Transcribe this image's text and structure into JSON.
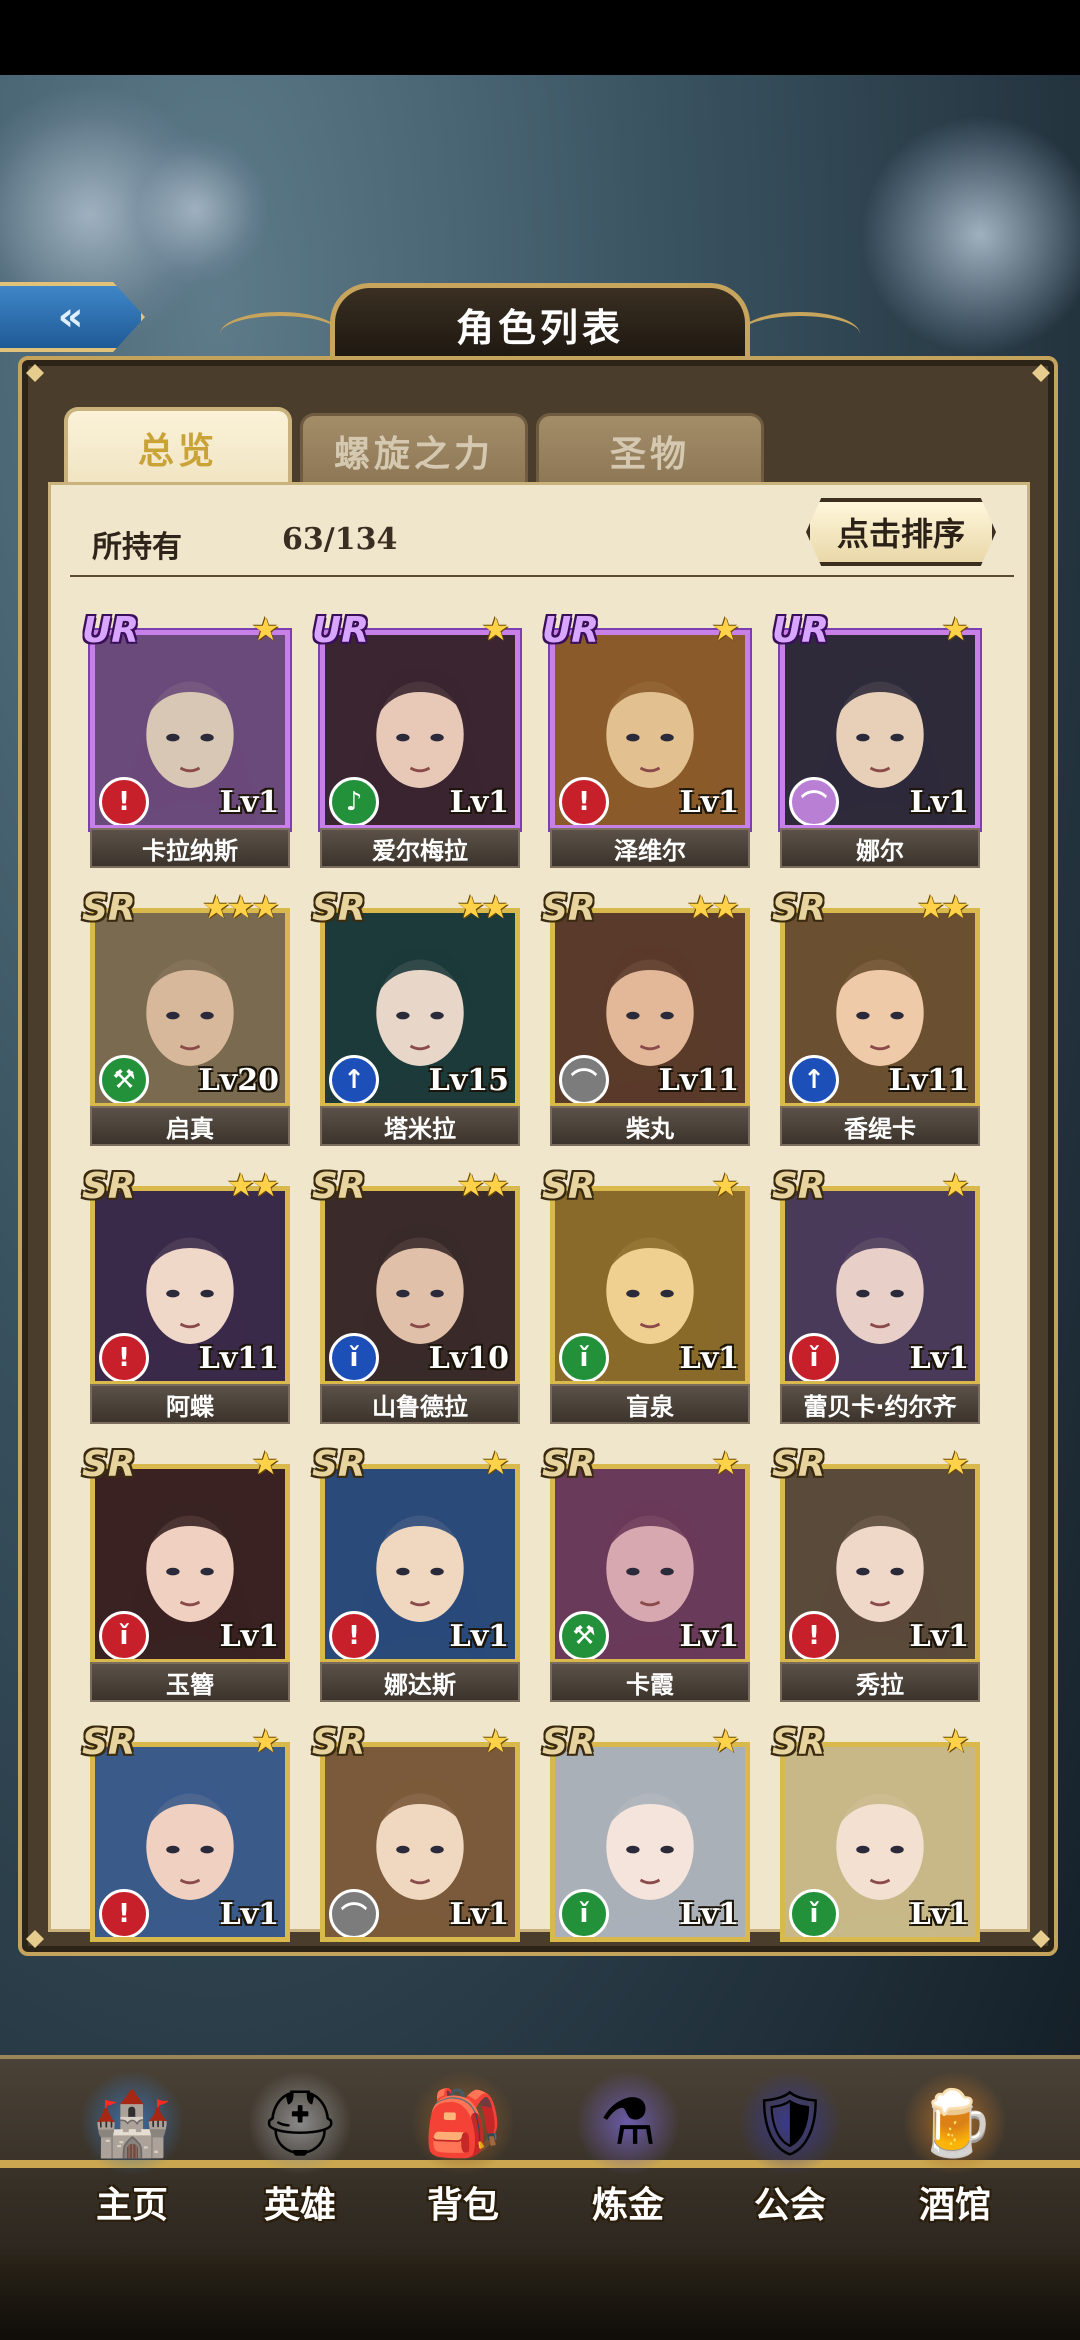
{
  "title": "角色列表",
  "back_icon": "double-chevron-left-icon",
  "tabs": [
    {
      "label": "总览",
      "active": true
    },
    {
      "label": "螺旋之力",
      "active": false
    },
    {
      "label": "圣物",
      "active": false
    }
  ],
  "owned": {
    "label": "所持有",
    "count": "63/134"
  },
  "sort_button": "点击排序",
  "class_colors": {
    "red": "#c8202b",
    "green": "#22913a",
    "blue": "#1d4fb8",
    "gray": "#7c7c7c",
    "purple": "#b97fd4"
  },
  "characters": [
    {
      "name": "卡拉纳斯",
      "rarity": "UR",
      "stars": 1,
      "level": "Lv1",
      "class_icon": "sword-icon",
      "class_color": "red"
    },
    {
      "name": "爱尔梅拉",
      "rarity": "UR",
      "stars": 1,
      "level": "Lv1",
      "class_icon": "harp-icon",
      "class_color": "green"
    },
    {
      "name": "泽维尔",
      "rarity": "UR",
      "stars": 1,
      "level": "Lv1",
      "class_icon": "sword-icon",
      "class_color": "red"
    },
    {
      "name": "娜尔",
      "rarity": "UR",
      "stars": 1,
      "level": "Lv1",
      "class_icon": "bow-icon",
      "class_color": "purple"
    },
    {
      "name": "启真",
      "rarity": "SR",
      "stars": 3,
      "level": "Lv20",
      "class_icon": "axe-icon",
      "class_color": "green"
    },
    {
      "name": "塔米拉",
      "rarity": "SR",
      "stars": 2,
      "level": "Lv15",
      "class_icon": "spear-icon",
      "class_color": "blue"
    },
    {
      "name": "柴丸",
      "rarity": "SR",
      "stars": 2,
      "level": "Lv11",
      "class_icon": "bow-icon",
      "class_color": "gray"
    },
    {
      "name": "香缇卡",
      "rarity": "SR",
      "stars": 2,
      "level": "Lv11",
      "class_icon": "spear-icon",
      "class_color": "blue"
    },
    {
      "name": "阿蝶",
      "rarity": "SR",
      "stars": 2,
      "level": "Lv11",
      "class_icon": "sword-icon",
      "class_color": "red"
    },
    {
      "name": "山鲁德拉",
      "rarity": "SR",
      "stars": 2,
      "level": "Lv10",
      "class_icon": "staff-icon",
      "class_color": "blue"
    },
    {
      "name": "盲泉",
      "rarity": "SR",
      "stars": 1,
      "level": "Lv1",
      "class_icon": "staff-icon",
      "class_color": "green"
    },
    {
      "name": "蕾贝卡·约尔齐",
      "rarity": "SR",
      "stars": 1,
      "level": "Lv1",
      "class_icon": "staff-icon",
      "class_color": "red"
    },
    {
      "name": "玉簪",
      "rarity": "SR",
      "stars": 1,
      "level": "Lv1",
      "class_icon": "staff-icon",
      "class_color": "red"
    },
    {
      "name": "娜达斯",
      "rarity": "SR",
      "stars": 1,
      "level": "Lv1",
      "class_icon": "sword-icon",
      "class_color": "red"
    },
    {
      "name": "卡霞",
      "rarity": "SR",
      "stars": 1,
      "level": "Lv1",
      "class_icon": "axe-icon",
      "class_color": "green"
    },
    {
      "name": "秀拉",
      "rarity": "SR",
      "stars": 1,
      "level": "Lv1",
      "class_icon": "sword-icon",
      "class_color": "red"
    },
    {
      "name": "",
      "rarity": "SR",
      "stars": 1,
      "level": "Lv1",
      "class_icon": "sword-icon",
      "class_color": "red"
    },
    {
      "name": "",
      "rarity": "SR",
      "stars": 1,
      "level": "Lv1",
      "class_icon": "bow-icon",
      "class_color": "gray"
    },
    {
      "name": "",
      "rarity": "SR",
      "stars": 1,
      "level": "Lv1",
      "class_icon": "staff-icon",
      "class_color": "green"
    },
    {
      "name": "",
      "rarity": "SR",
      "stars": 1,
      "level": "Lv1",
      "class_icon": "staff-icon",
      "class_color": "green"
    }
  ],
  "nav": [
    {
      "label": "主页",
      "icon": "castle-icon"
    },
    {
      "label": "英雄",
      "icon": "helmet-icon"
    },
    {
      "label": "背包",
      "icon": "backpack-icon"
    },
    {
      "label": "炼金",
      "icon": "potion-icon"
    },
    {
      "label": "公会",
      "icon": "guild-shield-icon"
    },
    {
      "label": "酒馆",
      "icon": "beer-mug-icon"
    }
  ]
}
